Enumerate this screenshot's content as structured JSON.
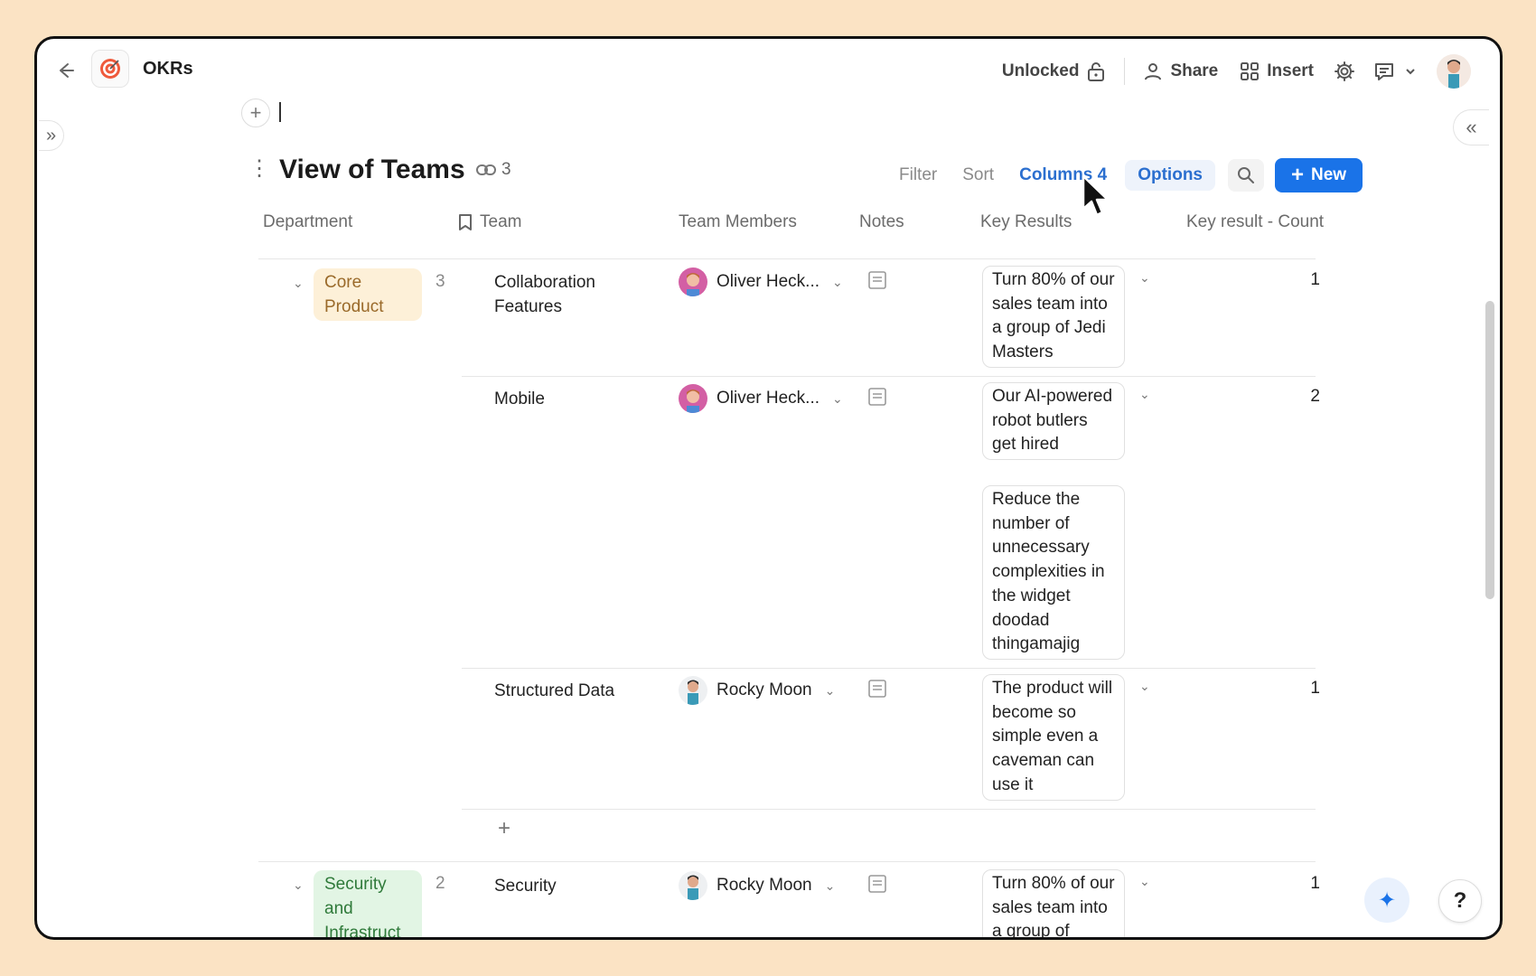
{
  "topbar": {
    "doc_title": "OKRs",
    "lock_label": "Unlocked",
    "share_label": "Share",
    "insert_label": "Insert"
  },
  "view": {
    "title": "View of Teams",
    "link_count": "3",
    "controls": {
      "filter": "Filter",
      "sort": "Sort",
      "columns": "Columns 4",
      "options": "Options",
      "new": "New"
    }
  },
  "table": {
    "headers": [
      "Department",
      "Team",
      "Team Members",
      "Notes",
      "Key Results",
      "Key result - Count"
    ],
    "groups": [
      {
        "department": "Core Product",
        "count": "3",
        "rows": [
          {
            "team": "Collaboration Features",
            "member": "Oliver Heck...",
            "key_results": [
              "Turn 80% of our sales team into a group of Jedi Masters"
            ],
            "count": "1"
          },
          {
            "team": "Mobile",
            "member": "Oliver Heck...",
            "key_results": [
              "Our AI-powered robot butlers get hired",
              "Reduce the number of unnecessary complexities in the widget doodad thingamajig"
            ],
            "count": "2"
          },
          {
            "team": "Structured Data",
            "member": "Rocky Moon",
            "key_results": [
              "The product will become so simple even a caveman can use it"
            ],
            "count": "1"
          }
        ]
      },
      {
        "department": "Security and Infrastruct",
        "count": "2",
        "rows": [
          {
            "team": "Security",
            "member": "Rocky Moon",
            "key_results": [
              "Turn 80% of our sales team into a group of"
            ],
            "count": "1"
          }
        ]
      }
    ]
  },
  "colors": {
    "accent": "#1a73e8",
    "core_tag_bg": "#fdf0d8",
    "core_tag_text": "#9a6a2a",
    "security_tag_bg": "#e2f5e4",
    "security_tag_text": "#2f7a3a"
  },
  "icons": [
    "back-arrow-icon",
    "target-icon",
    "lock-icon",
    "person-icon",
    "grid-icon",
    "gear-icon",
    "comment-icon",
    "chevron-down-icon",
    "link-icon",
    "search-icon",
    "plus-icon",
    "bookmark-icon",
    "note-icon",
    "sparkle-icon",
    "help-icon",
    "expand-icon",
    "collapse-icon"
  ]
}
